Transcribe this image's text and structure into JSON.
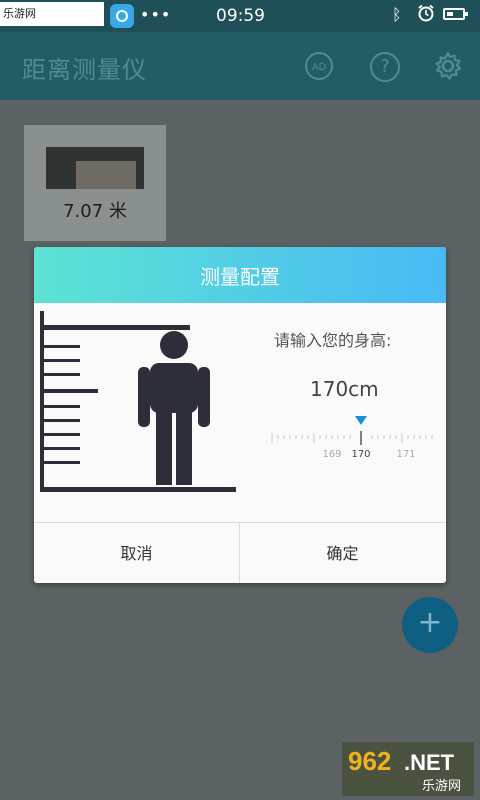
{
  "status_bar": {
    "watermark": "乐游网 www.962.net",
    "time": "09:59"
  },
  "app_bar": {
    "title": "距离测量仪",
    "ad_label": "AD",
    "help_label": "?"
  },
  "measurement_card": {
    "value": "7.07 米"
  },
  "fab": {
    "label": "+"
  },
  "dialog": {
    "title": "测量配置",
    "prompt": "请输入您的身高:",
    "height_value": "170cm",
    "ruler_ticks": [
      "169",
      "170",
      "171"
    ],
    "cancel_label": "取消",
    "ok_label": "确定"
  },
  "brand_watermark": {
    "logo": "962.NET",
    "sub": "乐游网"
  },
  "colors": {
    "header_start": "#5de3d4",
    "header_end": "#48b9f5",
    "pointer": "#1a8fd6",
    "fab": "#0e5f82"
  }
}
